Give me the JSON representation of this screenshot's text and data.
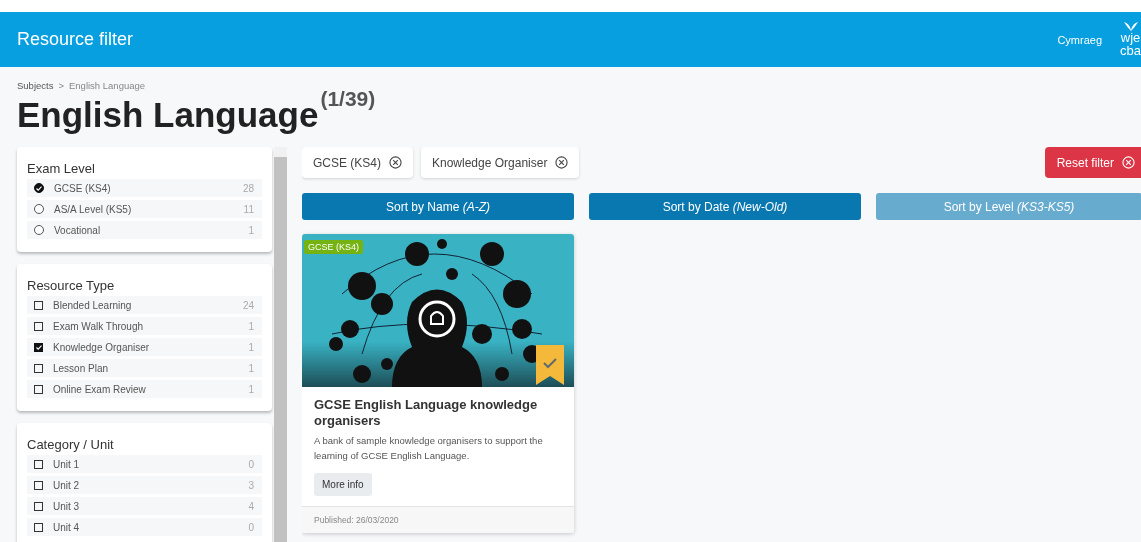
{
  "header": {
    "title": "Resource filter",
    "language_link": "Cymraeg",
    "logo_lines": [
      "wje",
      "cba"
    ]
  },
  "breadcrumb": [
    "Subjects",
    ">",
    "English Language"
  ],
  "page_title": {
    "text": "English Language",
    "count": "(1/39)"
  },
  "filter_panels": [
    {
      "title": "Exam Level",
      "kind": "radio",
      "items": [
        {
          "label": "GCSE (KS4)",
          "count": "28",
          "checked": true
        },
        {
          "label": "AS/A Level (KS5)",
          "count": "11",
          "checked": false
        },
        {
          "label": "Vocational",
          "count": "1",
          "checked": false
        }
      ]
    },
    {
      "title": "Resource Type",
      "kind": "checkbox",
      "items": [
        {
          "label": "Blended Learning",
          "count": "24",
          "checked": false
        },
        {
          "label": "Exam Walk Through",
          "count": "1",
          "checked": false
        },
        {
          "label": "Knowledge Organiser",
          "count": "1",
          "checked": true
        },
        {
          "label": "Lesson Plan",
          "count": "1",
          "checked": false
        },
        {
          "label": "Online Exam Review",
          "count": "1",
          "checked": false
        }
      ]
    },
    {
      "title": "Category / Unit",
      "kind": "checkbox",
      "items": [
        {
          "label": "Unit 1",
          "count": "0",
          "checked": false
        },
        {
          "label": "Unit 2",
          "count": "3",
          "checked": false
        },
        {
          "label": "Unit 3",
          "count": "4",
          "checked": false
        },
        {
          "label": "Unit 4",
          "count": "0",
          "checked": false
        }
      ]
    }
  ],
  "active_filters": [
    "GCSE (KS4)",
    "Knowledge Organiser"
  ],
  "reset_button": "Reset filter",
  "sort_buttons": [
    {
      "label": "Sort by Name *(A-Z)*",
      "dimmed": false
    },
    {
      "label": "Sort by Date *(New-Old)*",
      "dimmed": false
    },
    {
      "label": "Sort by Level *(KS3-KS5)*",
      "dimmed": true
    }
  ],
  "cards": [
    {
      "badge": "GCSE (KS4)",
      "bookmarked": true,
      "title": "GCSE English Language knowledge organisers",
      "description": "A bank of sample knowledge organisers to support the learning of GCSE English Language.",
      "button": "More info",
      "published": "Published: 26/03/2020"
    }
  ]
}
